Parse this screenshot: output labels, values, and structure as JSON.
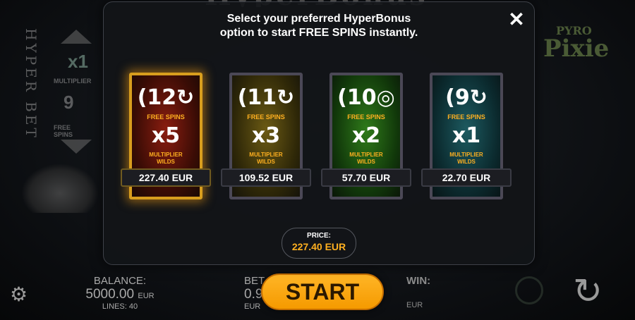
{
  "header": {
    "logo_text": "HyperBonus"
  },
  "hyperbet": {
    "vertical_text": "HYPER BET",
    "multiplier": "x1",
    "multiplier_label": "MULTIPLIER",
    "spins": "9",
    "spins_label": "FREE SPINS"
  },
  "game_logo": {
    "line1": "PYRO",
    "line2": "Pixie"
  },
  "dialog": {
    "message_line1": "Select your preferred HyperBonus",
    "message_line2": "option to start FREE SPINS instantly.",
    "close_icon": "close-icon",
    "options": [
      {
        "spins": "12",
        "free_spins_label": "FREE SPINS",
        "multiplier": "x5",
        "multiplier_label_1": "MULTIPLIER",
        "multiplier_label_2": "WILDS",
        "price": "227.40 EUR",
        "color": "#8a1d10",
        "selected": true
      },
      {
        "spins": "11",
        "free_spins_label": "FREE SPINS",
        "multiplier": "x3",
        "multiplier_label_1": "MULTIPLIER",
        "multiplier_label_2": "WILDS",
        "price": "109.52 EUR",
        "color": "#6b5a14",
        "selected": false
      },
      {
        "spins": "10",
        "free_spins_label": "FREE SPINS",
        "multiplier": "x2",
        "multiplier_label_1": "MULTIPLIER",
        "multiplier_label_2": "WILDS",
        "price": "57.70 EUR",
        "color": "#2f7a1a",
        "selected": false
      },
      {
        "spins": "9",
        "free_spins_label": "FREE SPINS",
        "multiplier": "x1",
        "multiplier_label_1": "MULTIPLIER",
        "multiplier_label_2": "WILDS",
        "price": "22.70 EUR",
        "color": "#1d5a60",
        "selected": false
      }
    ],
    "price_label": "PRICE:",
    "price_value": "227.40 EUR"
  },
  "bottom": {
    "balance_label": "BALANCE:",
    "balance_value": "5000.00",
    "balance_currency": "EUR",
    "lines": "LINES: 40",
    "bet_label": "BET",
    "bet_value": "0.9",
    "bet_currency": "EUR",
    "start_label": "START",
    "win_label": "WIN:",
    "win_currency": "EUR"
  },
  "colors": {
    "accent": "#f59a00",
    "label": "#ffb020",
    "selected_glow": "#d89e1e"
  }
}
